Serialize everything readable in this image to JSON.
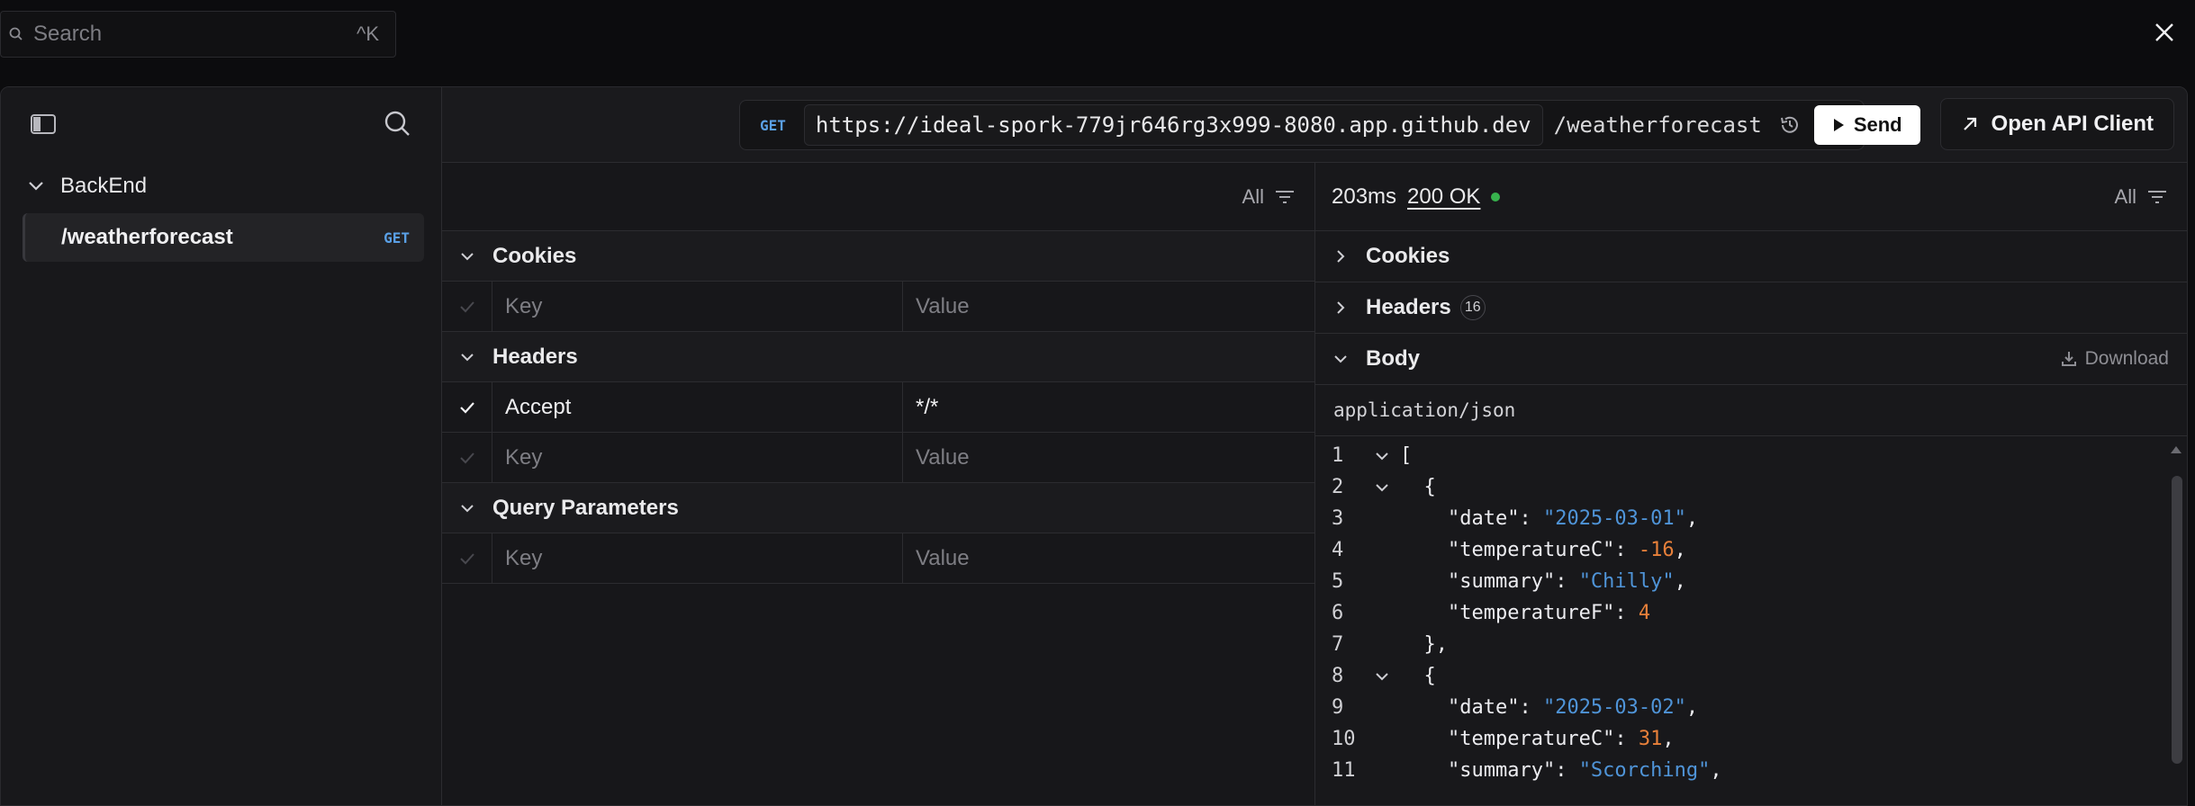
{
  "top": {
    "search_placeholder": "Search",
    "search_shortcut": "^K"
  },
  "sidebar": {
    "collection": "BackEnd",
    "route": {
      "path": "/weatherforecast",
      "method": "GET"
    }
  },
  "address": {
    "method": "GET",
    "host": "https://ideal-spork-779jr646rg3x999-8080.app.github.dev",
    "path": "/weatherforecast",
    "send_label": "Send"
  },
  "open_api_label": "Open API Client",
  "request": {
    "filter_label": "All",
    "sections": {
      "cookies": "Cookies",
      "headers": "Headers",
      "query": "Query Parameters"
    },
    "key_placeholder": "Key",
    "value_placeholder": "Value",
    "header_row": {
      "key": "Accept",
      "value": "*/*"
    }
  },
  "response": {
    "time": "203ms",
    "status": "200 OK",
    "filter_label": "All",
    "cookies": "Cookies",
    "headers": "Headers",
    "headers_count": "16",
    "body": "Body",
    "download": "Download",
    "content_type": "application/json"
  },
  "code_lines": [
    {
      "no": "1",
      "fold": true,
      "indent": "",
      "parts": [
        [
          "k",
          "["
        ]
      ]
    },
    {
      "no": "2",
      "fold": true,
      "indent": "  ",
      "parts": [
        [
          "k",
          "{"
        ]
      ]
    },
    {
      "no": "3",
      "fold": false,
      "indent": "    ",
      "parts": [
        [
          "k",
          "\"date\": "
        ],
        [
          "s",
          "\"2025-03-01\""
        ],
        [
          "k",
          ","
        ]
      ]
    },
    {
      "no": "4",
      "fold": false,
      "indent": "    ",
      "parts": [
        [
          "k",
          "\"temperatureC\": "
        ],
        [
          "n",
          "-16"
        ],
        [
          "k",
          ","
        ]
      ]
    },
    {
      "no": "5",
      "fold": false,
      "indent": "    ",
      "parts": [
        [
          "k",
          "\"summary\": "
        ],
        [
          "s",
          "\"Chilly\""
        ],
        [
          "k",
          ","
        ]
      ]
    },
    {
      "no": "6",
      "fold": false,
      "indent": "    ",
      "parts": [
        [
          "k",
          "\"temperatureF\": "
        ],
        [
          "n",
          "4"
        ]
      ]
    },
    {
      "no": "7",
      "fold": false,
      "indent": "  ",
      "parts": [
        [
          "k",
          "},"
        ]
      ]
    },
    {
      "no": "8",
      "fold": true,
      "indent": "  ",
      "parts": [
        [
          "k",
          "{"
        ]
      ]
    },
    {
      "no": "9",
      "fold": false,
      "indent": "    ",
      "parts": [
        [
          "k",
          "\"date\": "
        ],
        [
          "s",
          "\"2025-03-02\""
        ],
        [
          "k",
          ","
        ]
      ]
    },
    {
      "no": "10",
      "fold": false,
      "indent": "    ",
      "parts": [
        [
          "k",
          "\"temperatureC\": "
        ],
        [
          "n",
          "31"
        ],
        [
          "k",
          ","
        ]
      ]
    },
    {
      "no": "11",
      "fold": false,
      "indent": "    ",
      "parts": [
        [
          "k",
          "\"summary\": "
        ],
        [
          "s",
          "\"Scorching\""
        ],
        [
          "k",
          ","
        ]
      ]
    }
  ],
  "colors": {
    "accent_method": "#5aa0e6",
    "status_ok": "#37b24d",
    "json_string": "#4f94d8",
    "json_number": "#e8803a"
  }
}
